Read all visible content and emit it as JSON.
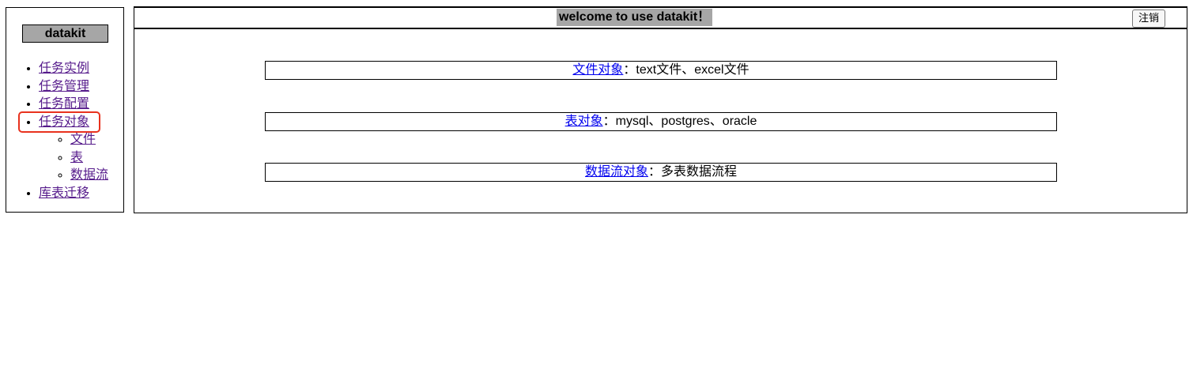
{
  "sidebar": {
    "brand": "datakit",
    "items": [
      {
        "label": "任务实例"
      },
      {
        "label": "任务管理"
      },
      {
        "label": "任务配置"
      },
      {
        "label": "任务对象",
        "highlighted": true,
        "children": [
          {
            "label": "文件"
          },
          {
            "label": "表"
          },
          {
            "label": "数据流"
          }
        ]
      },
      {
        "label": "库表迁移"
      }
    ]
  },
  "header": {
    "title": "welcome to use datakit！",
    "logout_label": "注销"
  },
  "main": {
    "objects": [
      {
        "link": "文件对象",
        "desc": "：text文件、excel文件"
      },
      {
        "link": "表对象",
        "desc": "：mysql、postgres、oracle"
      },
      {
        "link": "数据流对象",
        "desc": "：多表数据流程"
      }
    ]
  },
  "colors": {
    "highlight": "#e8321e",
    "title_bg": "#a6a6a6",
    "visited_link": "#551a8b",
    "link": "#0000ee"
  }
}
